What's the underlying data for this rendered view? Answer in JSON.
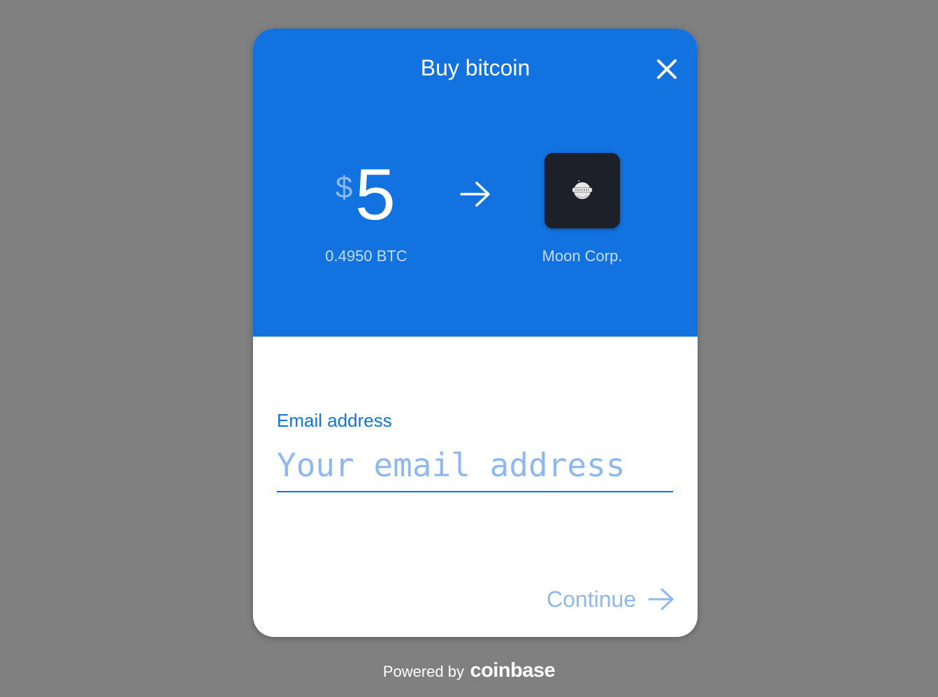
{
  "modal": {
    "title": "Buy bitcoin",
    "close_icon": "close-icon"
  },
  "payment": {
    "currency_symbol": "$",
    "amount": "5",
    "btc_amount": "0.4950 BTC",
    "arrow_icon": "arrow-right-icon"
  },
  "merchant": {
    "name": "Moon Corp.",
    "logo_icon": "moon-logo-icon"
  },
  "form": {
    "email_label": "Email address",
    "email_value": "",
    "email_placeholder": "Your email address",
    "continue_label": "Continue",
    "continue_icon": "arrow-right-icon"
  },
  "footer": {
    "powered_by": "Powered by",
    "brand": "coinbase"
  },
  "colors": {
    "background": "#808080",
    "primary": "#1172e0",
    "muted_blue": "#8fb8ee",
    "logo_tile": "#1e2029",
    "white": "#ffffff"
  }
}
